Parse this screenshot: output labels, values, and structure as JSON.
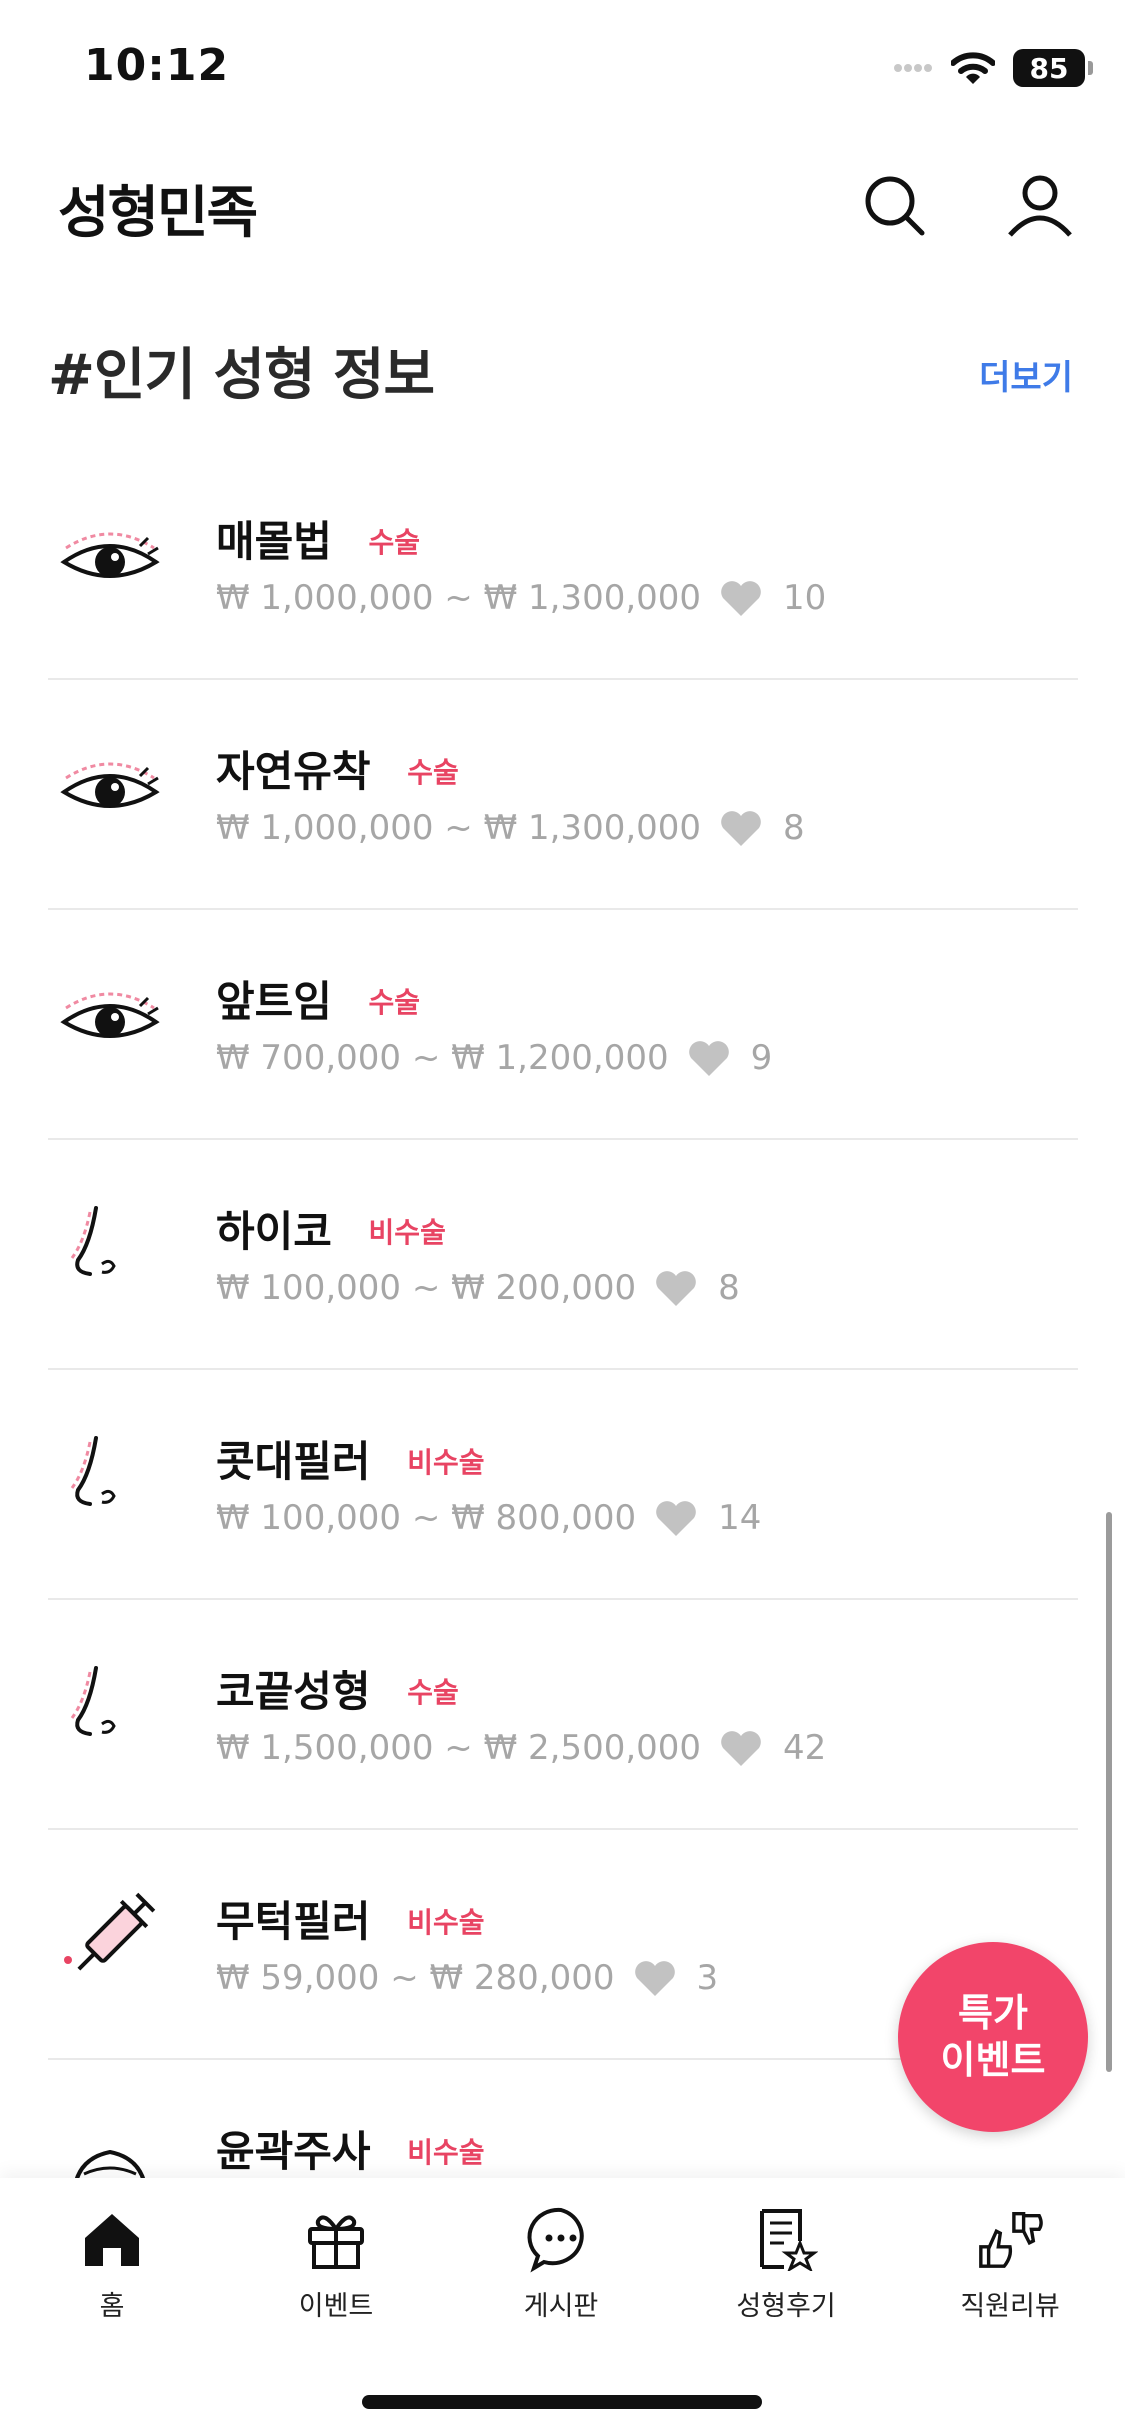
{
  "status_bar": {
    "time": "10:12",
    "battery": "85"
  },
  "header": {
    "brand": "성형민족",
    "search_icon": "search-icon",
    "profile_icon": "user-icon"
  },
  "section": {
    "title": "#인기 성형 정보",
    "more": "더보기"
  },
  "items": [
    {
      "name": "매몰법",
      "tag": "수술",
      "price": "₩ 1,000,000 ~ ₩ 1,300,000",
      "likes": "10",
      "icon": "eye-icon"
    },
    {
      "name": "자연유착",
      "tag": "수술",
      "price": "₩ 1,000,000 ~ ₩ 1,300,000",
      "likes": "8",
      "icon": "eye-icon"
    },
    {
      "name": "앞트임",
      "tag": "수술",
      "price": "₩ 700,000 ~ ₩ 1,200,000",
      "likes": "9",
      "icon": "eye-icon"
    },
    {
      "name": "하이코",
      "tag": "비수술",
      "price": "₩ 100,000 ~ ₩ 200,000",
      "likes": "8",
      "icon": "nose-icon"
    },
    {
      "name": "콧대필러",
      "tag": "비수술",
      "price": "₩ 100,000 ~ ₩ 800,000",
      "likes": "14",
      "icon": "nose-icon"
    },
    {
      "name": "코끝성형",
      "tag": "수술",
      "price": "₩ 1,500,000 ~ ₩ 2,500,000",
      "likes": "42",
      "icon": "nose-icon"
    },
    {
      "name": "무턱필러",
      "tag": "비수술",
      "price": "₩ 59,000 ~ ₩ 280,000",
      "likes": "3",
      "icon": "syringe-icon"
    },
    {
      "name": "윤곽주사",
      "tag": "비수술",
      "price": "",
      "likes": "",
      "icon": "face-icon"
    }
  ],
  "fab": {
    "line1": "특가",
    "line2": "이벤트"
  },
  "tabs": [
    {
      "label": "홈",
      "icon": "home-icon"
    },
    {
      "label": "이벤트",
      "icon": "gift-icon"
    },
    {
      "label": "게시판",
      "icon": "chat-icon"
    },
    {
      "label": "성형후기",
      "icon": "review-icon"
    },
    {
      "label": "직원리뷰",
      "icon": "thumbs-icon"
    }
  ],
  "colors": {
    "accent": "#f2456a",
    "tag": "#e84463",
    "link": "#3f7be8",
    "muted": "#a6a6a6"
  }
}
